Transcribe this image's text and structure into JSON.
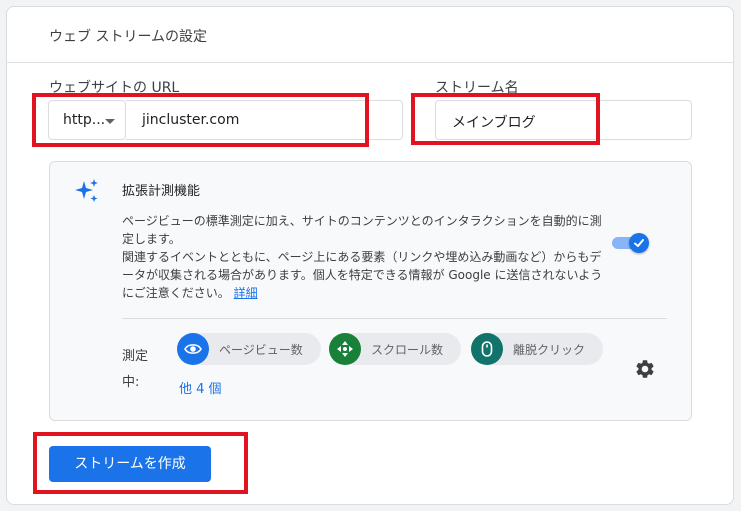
{
  "header": {
    "title": "ウェブ ストリームの設定"
  },
  "url_section": {
    "label": "ウェブサイトの URL",
    "protocol_value": "http...",
    "url_value": "jincluster.com"
  },
  "stream_section": {
    "label": "ストリーム名",
    "value": "メインブログ"
  },
  "enhanced": {
    "title": "拡張計測機能",
    "description": "ページビューの標準測定に加え、サイトのコンテンツとのインタラクションを自動的に測定します。",
    "description2": "関連するイベントとともに、ページ上にある要素（リンクや埋め込み動画など）からもデータが収集される場合があります。個人を特定できる情報が Google に送信されないようにご注意ください。",
    "detail_link": "詳細",
    "toggle_on": true,
    "measuring_label": "測定中:",
    "chips": [
      {
        "label": "ページビュー数",
        "icon": "eye-icon",
        "color": "#1a73e8"
      },
      {
        "label": "スクロール数",
        "icon": "scroll-icon",
        "color": "#188038"
      },
      {
        "label": "離脱クリック",
        "icon": "mouse-icon",
        "color": "#12736b"
      }
    ],
    "more_label": "他 4 個"
  },
  "actions": {
    "create_label": "ストリームを作成"
  },
  "colors": {
    "primary": "#1a73e8",
    "highlight": "#e0141e"
  }
}
